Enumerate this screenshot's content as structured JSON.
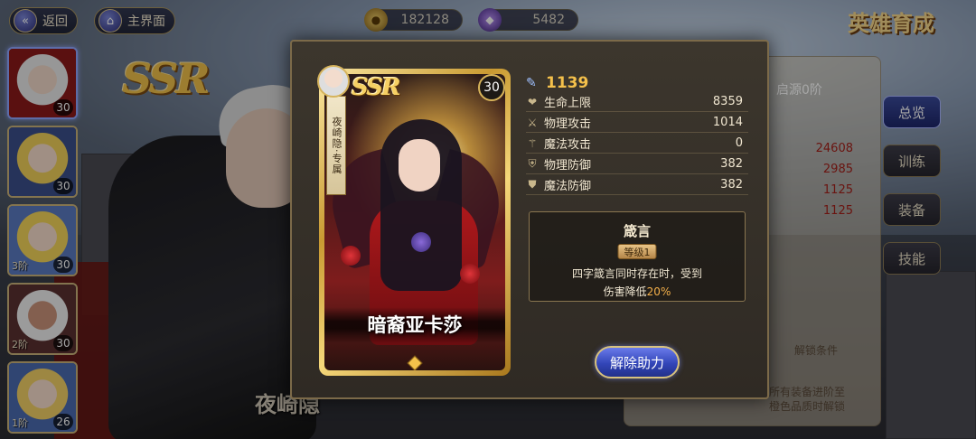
{
  "topbar": {
    "back_label": "返回",
    "home_label": "主界面",
    "gold": "182128",
    "gems": "5482",
    "page_title": "英雄育成"
  },
  "background": {
    "rarity": "SSR",
    "hero_name": "夜崎隐",
    "panel": {
      "source_label": "启源0阶",
      "values": [
        "24608",
        "2985",
        "1125",
        "1125"
      ],
      "unlock_hint": "解锁条件",
      "footer_text": [
        "所有装备进阶至",
        "橙色品质时解锁"
      ]
    }
  },
  "hero_list": [
    {
      "level": "30",
      "stage": "",
      "selected": true
    },
    {
      "level": "30",
      "stage": "",
      "selected": false
    },
    {
      "level": "30",
      "stage": "3阶",
      "selected": false
    },
    {
      "level": "30",
      "stage": "2阶",
      "selected": false
    },
    {
      "level": "26",
      "stage": "1阶",
      "selected": false
    }
  ],
  "side_tabs": [
    {
      "label": "总览",
      "active": true
    },
    {
      "label": "训练",
      "active": false
    },
    {
      "label": "装备",
      "active": false
    },
    {
      "label": "技能",
      "active": false
    }
  ],
  "modal": {
    "card": {
      "rarity": "SSR",
      "level": "30",
      "exclusive_tag": "夜崎隐·专属",
      "name": "暗裔亚卡莎"
    },
    "power": "1139",
    "stats": [
      {
        "icon": "heart-icon",
        "name": "生命上限",
        "value": "8359"
      },
      {
        "icon": "sword-icon",
        "name": "物理攻击",
        "value": "1014"
      },
      {
        "icon": "wand-icon",
        "name": "魔法攻击",
        "value": "0"
      },
      {
        "icon": "shield-icon",
        "name": "物理防御",
        "value": "382"
      },
      {
        "icon": "magic-shield-icon",
        "name": "魔法防御",
        "value": "382"
      }
    ],
    "effect": {
      "title": "箴言",
      "level": "等级1",
      "desc_line1": "四字箴言同时存在时，受到",
      "desc_line2_prefix": "伤害降低",
      "desc_highlight": "20%"
    },
    "release_button": "解除助力"
  }
}
